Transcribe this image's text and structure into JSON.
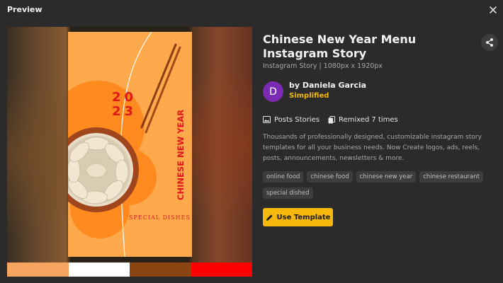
{
  "header": {
    "title": "Preview"
  },
  "template": {
    "title": "Chinese New Year Menu Instagram Story",
    "subtitle": "Instagram Story | 1080px x 1920px"
  },
  "author": {
    "initial": "D",
    "name": "by Daniela Garcia",
    "brand": "Simplified",
    "avatar_color": "#7b2bb3"
  },
  "stats": {
    "category": "Posts Stories",
    "remixed": "Remixed 7 times"
  },
  "description": "Thousands of professionally designed, customizable instagram story templates for all your business needs. Now Create logos, ads, reels, posts, announcements, newsletters & more.",
  "tags": [
    "online food",
    "chinese food",
    "chinese new year",
    "chinese restaurant",
    "special dished"
  ],
  "cta": {
    "label": "Use Template"
  },
  "story": {
    "year_top": "20",
    "year_bottom": "23",
    "vertical_text": "CHINESE NEW YEAR",
    "footer_text": "SPECIAL DISHES"
  },
  "palette": [
    "#f5a55f",
    "#ffffff",
    "#8b4513",
    "#ff0000"
  ],
  "colors": {
    "accent": "#f6b80d",
    "background": "#2b2b2b"
  },
  "icons": {
    "close": "close-icon",
    "share": "share-icon",
    "image": "image-icon",
    "copy": "copy-icon",
    "pencil": "pencil-icon"
  }
}
